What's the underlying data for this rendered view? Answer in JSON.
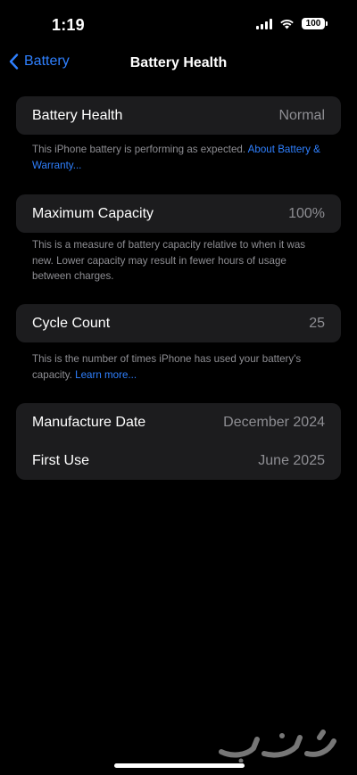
{
  "status_bar": {
    "time": "1:19",
    "battery_level": "100"
  },
  "nav": {
    "back_label": "Battery",
    "title": "Battery Health"
  },
  "sections": {
    "battery_health": {
      "label": "Battery Health",
      "value": "Normal",
      "footnote": "This iPhone battery is performing as expected. ",
      "link": "About Battery & Warranty..."
    },
    "maximum_capacity": {
      "label": "Maximum Capacity",
      "value": "100%",
      "footnote": "This is a measure of battery capacity relative to when it was new. Lower capacity may result in fewer hours of usage between charges."
    },
    "cycle_count": {
      "label": "Cycle Count",
      "value": "25",
      "footnote": "This is the number of times iPhone has used your battery's capacity. ",
      "link": "Learn more..."
    },
    "dates": {
      "manufacture_label": "Manufacture Date",
      "manufacture_value": "December 2024",
      "first_use_label": "First Use",
      "first_use_value": "June 2025"
    }
  },
  "watermark": {
    "text": "حراج"
  },
  "colors": {
    "background": "#000000",
    "card": "#1c1c1e",
    "accent": "#2f80ff",
    "secondary_text": "#8e8e93"
  }
}
